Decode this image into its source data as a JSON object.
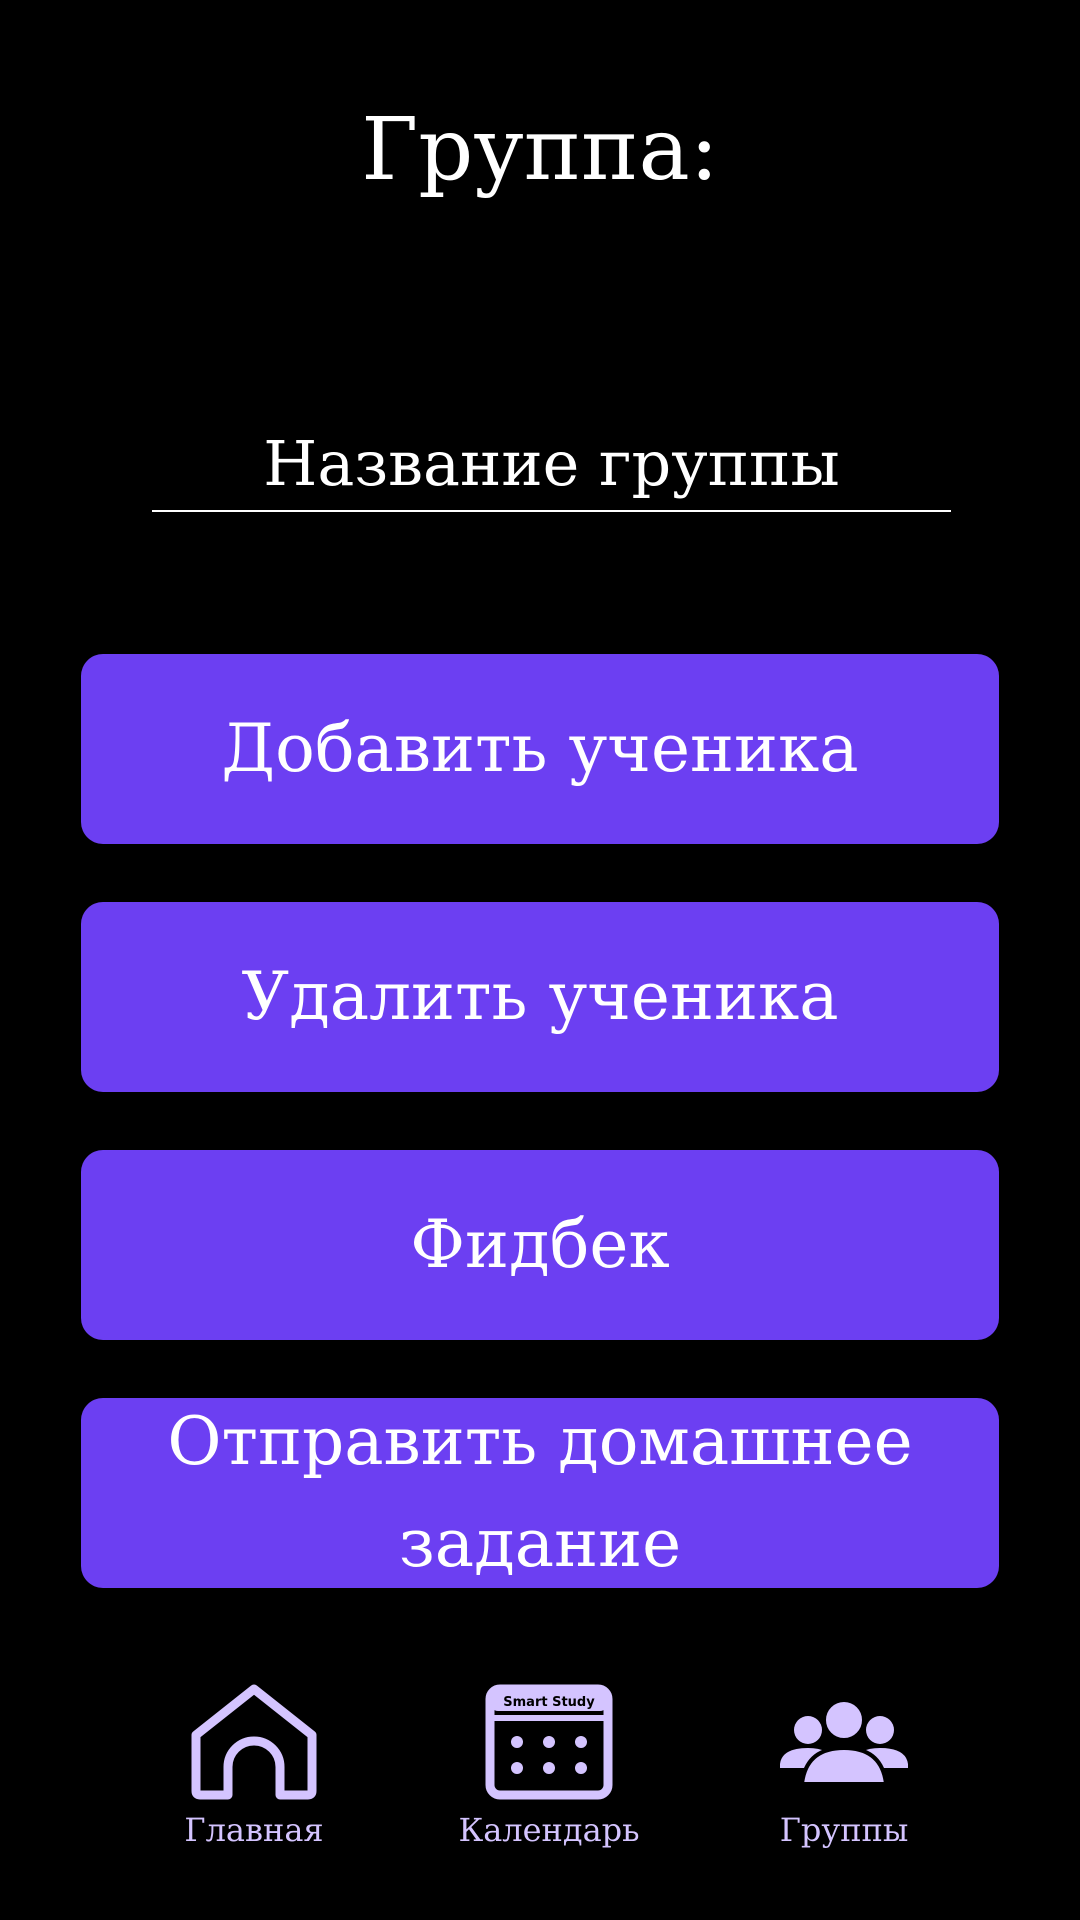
{
  "header": {
    "title": "Группа:"
  },
  "group_name": {
    "value": "Название группы"
  },
  "actions": [
    {
      "label": "Добавить ученика"
    },
    {
      "label": "Удалить ученика"
    },
    {
      "label": "Фидбек"
    },
    {
      "label": "Отправить домашнее задание"
    }
  ],
  "bottom_nav": {
    "items": [
      {
        "label": "Главная",
        "icon": "home-icon"
      },
      {
        "label": "Календарь",
        "icon": "calendar-icon",
        "icon_text": "Smart Study"
      },
      {
        "label": "Группы",
        "icon": "groups-icon"
      }
    ]
  },
  "colors": {
    "background": "#000000",
    "button": "#6c3ff2",
    "nav_accent": "#d4c4ff",
    "text": "#ffffff"
  }
}
